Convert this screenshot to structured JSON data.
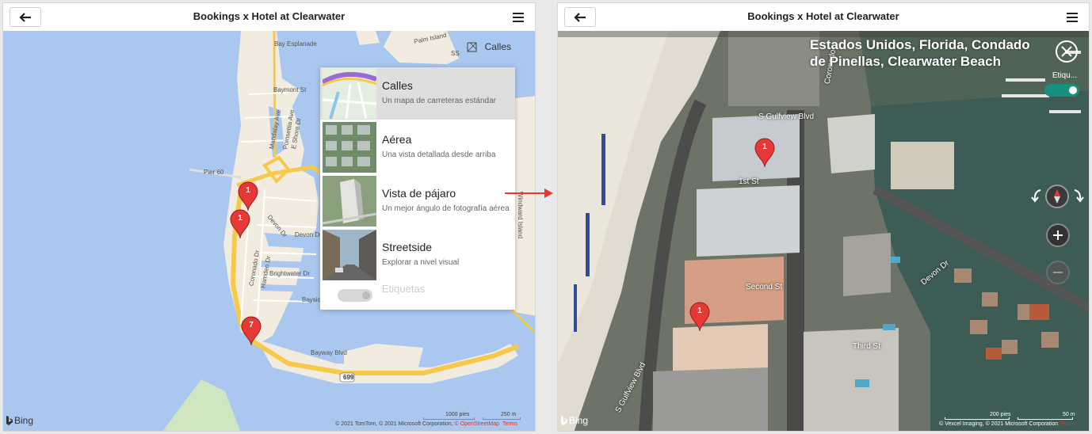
{
  "left": {
    "header": {
      "title": "Bookings x Hotel at Clearwater"
    },
    "style_button": {
      "label": "Calles"
    },
    "map_labels": {
      "bay_esplanade": "Bay Esplanade",
      "palm_island": "Palm Island",
      "baymont": "Baymont St",
      "mandalay": "Mandalay Ave",
      "poinsettia": "Poinsettia Ave",
      "eshore": "E Shore Dr",
      "pier60": "Pier 60",
      "devon1": "Devon Dr",
      "devon2": "Devon Dr",
      "coronado": "Coronado Dr",
      "hamden": "Hamden Dr",
      "brightwater": "Brightwater Dr",
      "bayside": "Baysid",
      "bayway": "Bayway Blvd",
      "windward": "Windward Island",
      "route": "699",
      "palm_island_ss": "SS"
    },
    "pins": [
      "1",
      "1",
      "7"
    ],
    "dropdown": {
      "items": [
        {
          "label": "Calles",
          "desc": "Un mapa de carreteras estándar"
        },
        {
          "label": "Aérea",
          "desc": "Una vista detallada desde arriba"
        },
        {
          "label": "Vista de pájaro",
          "desc": "Un mejor ángulo de fotografía aérea"
        },
        {
          "label": "Streetside",
          "desc": "Explorar a nivel visual"
        }
      ],
      "labels_toggle": "Etiquetas"
    },
    "bing": "Bing",
    "scale": {
      "imperial": "1000 pies",
      "metric": "250 m"
    },
    "copyright": {
      "text": "© 2021 TomTom, © 2021 Microsoft Corporation, ",
      "osm": "© OpenStreetMap",
      "terms": "Terms"
    }
  },
  "right": {
    "header": {
      "title": "Bookings x Hotel at Clearwater"
    },
    "location": "Estados Unidos, Florida, Condado de Pinellas, Clearwater Beach",
    "labels_toggle": "Etiqu...",
    "streets": {
      "gulfview1": "S Gulfview Blvd",
      "gulfview2": "S Gulfview Blvd",
      "first": "1st St",
      "second": "Second St",
      "third": "Third St",
      "devon": "Devon Dr",
      "coronado": "Coronado"
    },
    "pins": [
      "1",
      "1"
    ],
    "bing": "Bing",
    "scale": {
      "imperial": "200 pies",
      "metric": "50 m"
    },
    "copyright": {
      "text": "© Vexcel Imaging, © 2021 Microsoft Corporation ",
      "terms": "Terms"
    }
  },
  "colors": {
    "water": "#a9c7ef",
    "land": "#f1ecdf",
    "road": "#f7c94a",
    "pin": "#e53935",
    "toggle_on": "#17907f",
    "arrow": "#e53935"
  }
}
